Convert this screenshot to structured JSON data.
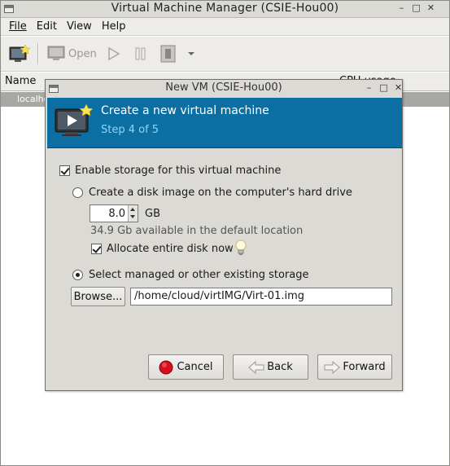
{
  "main_window": {
    "title": "Virtual Machine Manager (CSIE-Hou00)",
    "menu": [
      "File",
      "Edit",
      "View",
      "Help"
    ],
    "toolbar": {
      "open_label": "Open"
    },
    "columns": {
      "name": "Name",
      "cpu": "CPU usage"
    },
    "connection_row": "localho"
  },
  "dialog": {
    "title": "New VM (CSIE-Hou00)",
    "heading": "Create a new virtual machine",
    "step": "Step 4 of 5",
    "enable_storage": {
      "label": "Enable storage for this virtual machine",
      "checked": true
    },
    "create_disk": {
      "label": "Create a disk image on the computer's hard drive",
      "selected": false
    },
    "size": {
      "value": "8.0",
      "unit": "GB"
    },
    "available_text": "34.9 Gb available in the default location",
    "allocate": {
      "label": "Allocate entire disk now",
      "checked": true
    },
    "managed": {
      "label": "Select managed or other existing storage",
      "selected": true
    },
    "browse_label": "Browse...",
    "path_value": "/home/cloud/virtIMG/Virt-01.img",
    "buttons": {
      "cancel": "Cancel",
      "back": "Back",
      "forward": "Forward"
    }
  }
}
